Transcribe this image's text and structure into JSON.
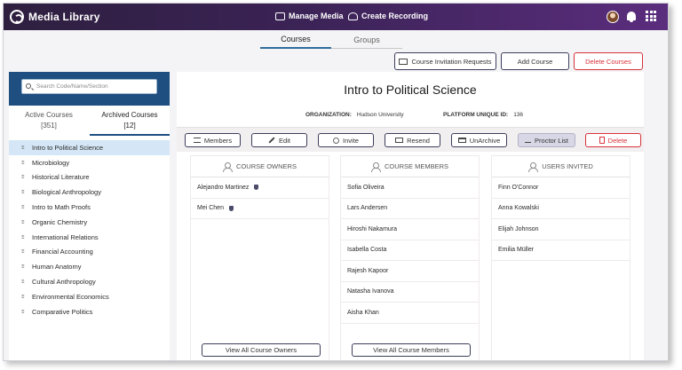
{
  "topbar": {
    "app_title": "Media Library",
    "manage_media": "Manage Media",
    "create_recording": "Create Recording"
  },
  "tabs": [
    {
      "label": "Courses",
      "active": true
    },
    {
      "label": "Groups",
      "active": false
    }
  ],
  "toolbar": {
    "invitation_requests": "Course Invitation Requests",
    "add_course": "Add Course",
    "delete_courses": "Delete Courses"
  },
  "sidebar": {
    "search_placeholder": "Search Code/Name/Section",
    "active_label": "Active Courses",
    "active_count": "[351]",
    "archived_label": "Archived Courses",
    "archived_count": "[12]",
    "courses": [
      "Intro to Political Science",
      "Microbiology",
      "Historical Literature",
      "Biological Anthropology",
      "Intro to Math Proofs",
      "Organic Chemistry",
      "International Relations",
      "Financial Accounting",
      "Human Anatomy",
      "Cultural Anthropology",
      "Environmental Economics",
      "Comparative Politics"
    ],
    "selected_index": 0
  },
  "course": {
    "title": "Intro to Political Science",
    "org_label": "ORGANIZATION:",
    "org_value": "Hudson University",
    "pid_label": "PLATFORM UNIQUE ID:",
    "pid_value": "136"
  },
  "actions": {
    "members": "Members",
    "edit": "Edit",
    "invite": "Invite",
    "resend": "Resend",
    "unarchive": "UnArchive",
    "proctor_list": "Proctor List",
    "delete": "Delete"
  },
  "columns": {
    "owners": {
      "title": "COURSE OWNERS",
      "items": [
        "Alejandro Martinez",
        "Mei Chen"
      ],
      "view_all": "View All Course Owners"
    },
    "members": {
      "title": "COURSE MEMBERS",
      "items": [
        "Sofia Oliveira",
        "Lars Andersen",
        "Hiroshi Nakamura",
        "Isabella Costa",
        "Rajesh Kapoor",
        "Natasha Ivanova",
        "Aisha Khan"
      ],
      "view_all": "View All Course Members"
    },
    "invited": {
      "title": "USERS INVITED",
      "items": [
        "Finn O'Connor",
        "Anna Kowalski",
        "Elijah Johnson",
        "Emilia Müller"
      ]
    }
  },
  "colors": {
    "topbar_start": "#2e1f3f",
    "topbar_end": "#5b2d7e",
    "sidebar_header": "#1e4f80",
    "selected_row": "#d5e7f6",
    "danger": "#d8323a",
    "tab_accent": "#2f6e9b"
  }
}
